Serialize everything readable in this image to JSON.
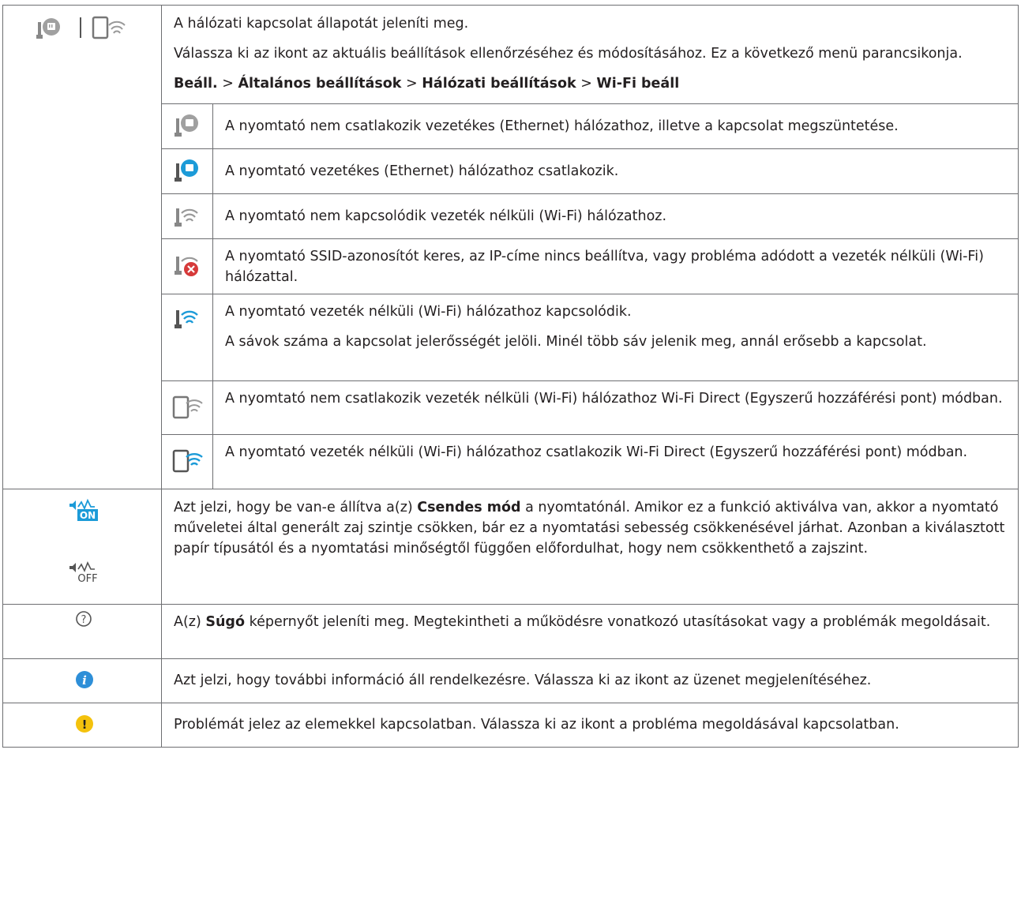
{
  "network": {
    "intro": "A hálózati kapcsolat állapotát jeleníti meg.",
    "desc": "Válassza ki az ikont az aktuális beállítások ellenőrzéséhez és módosításához. Ez a következő menü parancsikonja.",
    "path": [
      "Beáll.",
      "Általános beállítások",
      "Hálózati beállítások",
      "Wi-Fi beáll"
    ],
    "path_sep": " > ",
    "rows": [
      {
        "icon": "ethernet-disconnected-icon",
        "text": "A nyomtató nem csatlakozik vezetékes (Ethernet) hálózathoz, illetve a kapcsolat megszüntetése."
      },
      {
        "icon": "ethernet-connected-icon",
        "text": "A nyomtató vezetékes (Ethernet) hálózathoz csatlakozik."
      },
      {
        "icon": "wifi-disconnected-icon",
        "text": "A nyomtató nem kapcsolódik vezeték nélküli (Wi-Fi) hálózathoz."
      },
      {
        "icon": "wifi-error-icon",
        "text": "A nyomtató SSID-azonosítót keres, az IP-címe nincs beállítva, vagy probléma adódott a vezeték nélküli (Wi-Fi) hálózattal."
      },
      {
        "icon": "wifi-connected-icon",
        "text": "A nyomtató vezeték nélküli (Wi-Fi) hálózathoz kapcsolódik.",
        "text2": "A sávok száma a kapcsolat jelerősségét jelöli. Minél több sáv jelenik meg, annál erősebb a kapcsolat."
      },
      {
        "icon": "wifi-direct-disconnected-icon",
        "text": "A nyomtató nem csatlakozik vezeték nélküli (Wi-Fi) hálózathoz Wi-Fi Direct (Egyszerű hozzáférési pont) módban."
      },
      {
        "icon": "wifi-direct-connected-icon",
        "text": "A nyomtató vezeték nélküli (Wi-Fi) hálózathoz csatlakozik Wi-Fi Direct (Egyszerű hozzáférési pont) módban."
      }
    ]
  },
  "quiet": {
    "pre": "Azt jelzi, hogy be van-e állítva a(z) ",
    "bold": "Csendes mód",
    "post": " a nyomtatónál. Amikor ez a funkció aktiválva van, akkor a nyomtató műveletei által generált zaj szintje csökken, bár ez a nyomtatási sebesség csökkenésével járhat. Azonban a kiválasztott papír típusától és a nyomtatási minőségtől függően előfordulhat, hogy nem csökkenthető a zajszint.",
    "on_label": "ON",
    "off_label": "OFF"
  },
  "help": {
    "pre": "A(z) ",
    "bold": "Súgó",
    "post": " képernyőt jeleníti meg. Megtekintheti a működésre vonatkozó utasításokat vagy a problémák megoldásait.",
    "glyph": "?"
  },
  "info": {
    "text": "Azt jelzi, hogy további információ áll rendelkezésre. Válassza ki az ikont az üzenet megjelenítéséhez.",
    "glyph": "i"
  },
  "warning": {
    "text": "Problémát jelez az elemekkel kapcsolatban. Válassza ki az ikont a probléma megoldásával kapcsolatban.",
    "glyph": "!"
  },
  "colors": {
    "border": "#6d6e71",
    "wifi_blue": "#1c9bd8",
    "info_blue": "#2e8fd8",
    "warning_yellow": "#f4c20d",
    "error_red": "#d63a3a",
    "icon_gray": "#7a7a7a"
  }
}
